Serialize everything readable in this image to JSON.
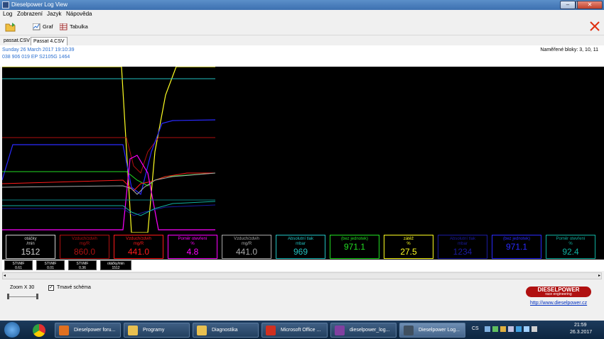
{
  "window": {
    "title": "Dieselpower Log View"
  },
  "menu": [
    "Log",
    "Zobrazení",
    "Jazyk",
    "Nápověda"
  ],
  "toolbar": {
    "graf_label": "Graf",
    "tabulka_label": "Tabulka"
  },
  "tabs": [
    "passat.CSV",
    "Passat 4.CSV"
  ],
  "info": {
    "date": "Sunday 26 March 2017 19:10:39",
    "ecu": "038 906 019 EP  S2105G  1464",
    "blocks": "Naměřené bloky: 3, 10, 11"
  },
  "cards": [
    {
      "name": "otáčky",
      "unit": "/min",
      "value": "1512",
      "color": "#d0d0d0"
    },
    {
      "name": "Vzduch/zdvih",
      "unit": "mg/R",
      "value": "860.0",
      "color": "#b01010"
    },
    {
      "name": "Vzduch/zdvih",
      "unit": "mg/R",
      "value": "441.0",
      "color": "#ff1a1a"
    },
    {
      "name": "Poměr otevření",
      "unit": "%",
      "value": "4.8",
      "color": "#ff00ff"
    },
    {
      "name": "Vzduch/zdvih",
      "unit": "mg/R",
      "value": "441.0",
      "color": "#a8a8a8"
    },
    {
      "name": "Absolutní tlak",
      "unit": "mbar",
      "value": "969",
      "color": "#22c0c0"
    },
    {
      "name": "(bez jednotek)",
      "unit": "",
      "value": "971.1",
      "color": "#22dd22"
    },
    {
      "name": "zátěž",
      "unit": "%",
      "value": "27.5",
      "color": "#ffff22"
    },
    {
      "name": "Absolutní tlak",
      "unit": "mbar",
      "value": "1234",
      "color": "#1a1aa0"
    },
    {
      "name": "(bez jednotek)",
      "unit": "",
      "value": "971.1",
      "color": "#2a2aff"
    },
    {
      "name": "Poměr otevření",
      "unit": "%",
      "value": "92.4",
      "color": "#10b0a0"
    }
  ],
  "mini_cards": [
    {
      "name": "STVMF",
      "value": "0.61"
    },
    {
      "name": "STVMF",
      "value": "0.01"
    },
    {
      "name": "STVMF",
      "value": "0.36"
    },
    {
      "name": "otáčky/min",
      "value": "1512"
    }
  ],
  "zoom": {
    "label": "Zoom X  30"
  },
  "dark_scheme": {
    "label": "Tmavé schéma",
    "checked": true
  },
  "brand": {
    "name": "DIESELPOWER",
    "tagline": "race engineering",
    "link": "http://www.dieselpower.cz"
  },
  "taskbar": {
    "items": [
      "Dieselpower foru...",
      "Programy",
      "Diagnostika",
      "Microsoft Office ...",
      "dieselpower_log...",
      "Dieselpower Log..."
    ],
    "lang": "CS",
    "time": "21:59",
    "date": "26.3.2017"
  }
}
